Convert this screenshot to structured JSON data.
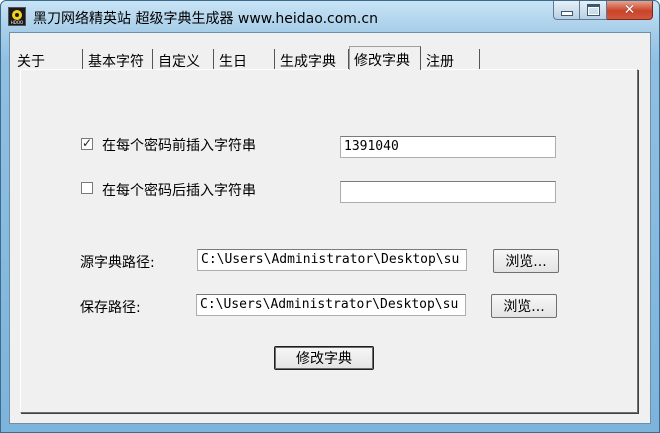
{
  "window": {
    "title": "黑刀网络精英站 超级字典生成器 www.heidao.com.cn",
    "icon": "radiation-icon",
    "icon_text": "HDOO"
  },
  "tabs": [
    {
      "label": "关于",
      "active": false
    },
    {
      "label": "基本字符",
      "active": false
    },
    {
      "label": "自定义",
      "active": false
    },
    {
      "label": "生日",
      "active": false
    },
    {
      "label": "生成字典",
      "active": false
    },
    {
      "label": "修改字典",
      "active": true
    },
    {
      "label": "注册",
      "active": false
    }
  ],
  "prefix": {
    "checked": true,
    "label": "在每个密码前插入字符串",
    "value": "1391040"
  },
  "suffix": {
    "checked": false,
    "label": "在每个密码后插入字符串",
    "value": ""
  },
  "source": {
    "label": "源字典路径:",
    "value": "C:\\Users\\Administrator\\Desktop\\su",
    "browse_label": "浏览..."
  },
  "save": {
    "label": "保存路径:",
    "value": "C:\\Users\\Administrator\\Desktop\\su",
    "browse_label": "浏览..."
  },
  "modify_button": "修改字典",
  "colors": {
    "title_gradient_top": "#c9e4f6",
    "close_button": "#c9432a",
    "panel_bg": "#f0f0f0"
  }
}
